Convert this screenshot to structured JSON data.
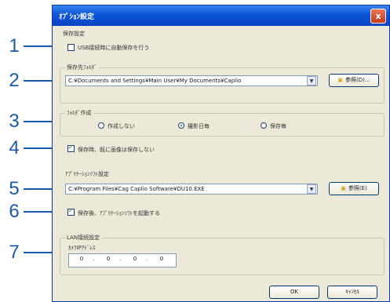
{
  "callouts": [
    "1",
    "2",
    "3",
    "4",
    "5",
    "6",
    "7"
  ],
  "dialog": {
    "title": "ｵﾌﾟｼｮﾝ設定",
    "close_label": "x"
  },
  "save_settings": {
    "group_label": "保存設定",
    "auto_save_label": "USB接続時に自動保存を行う",
    "auto_save_checked": false,
    "folder_label": "保存先ﾌｫﾙﾀﾞ",
    "folder_value": "C:¥Documents and Settings¥Main User¥My Documents¥Caplio",
    "browse_label": "参照(D)..."
  },
  "folder_create": {
    "group_label": "ﾌｫﾙﾀﾞ作成",
    "options": [
      "作成しない",
      "撮影日毎",
      "保存毎"
    ],
    "selected_index": 1
  },
  "skip_existing": {
    "label": "保存時、既に画像は保存しない",
    "checked": true
  },
  "app_settings": {
    "group_label": "ｱﾌﾟﾘｹｰｼｮﾝｿﾌﾄ設定",
    "path_value": "C:¥Program Files¥Cag Caplio Software¥DU10.EXE",
    "browse_label": "参照(E)",
    "launch_label": "保存後、ｱﾌﾟﾘｹｰｼｮﾝｿﾌﾄを起動する",
    "launch_checked": true
  },
  "lan_settings": {
    "group_label": "LAN接続設定",
    "ip_label": "ｶﾒﾗIPｱﾄﾞﾚｽ",
    "octets": [
      "0",
      "0",
      "0",
      "0"
    ],
    "dot": "."
  },
  "footer": {
    "ok_label": "OK",
    "cancel_label": "ｷｬﾝｾﾙ"
  },
  "colors": {
    "callout": "#1a5aa8",
    "titlebar": "#0b55d8",
    "dialog_bg": "#ece9d8"
  }
}
